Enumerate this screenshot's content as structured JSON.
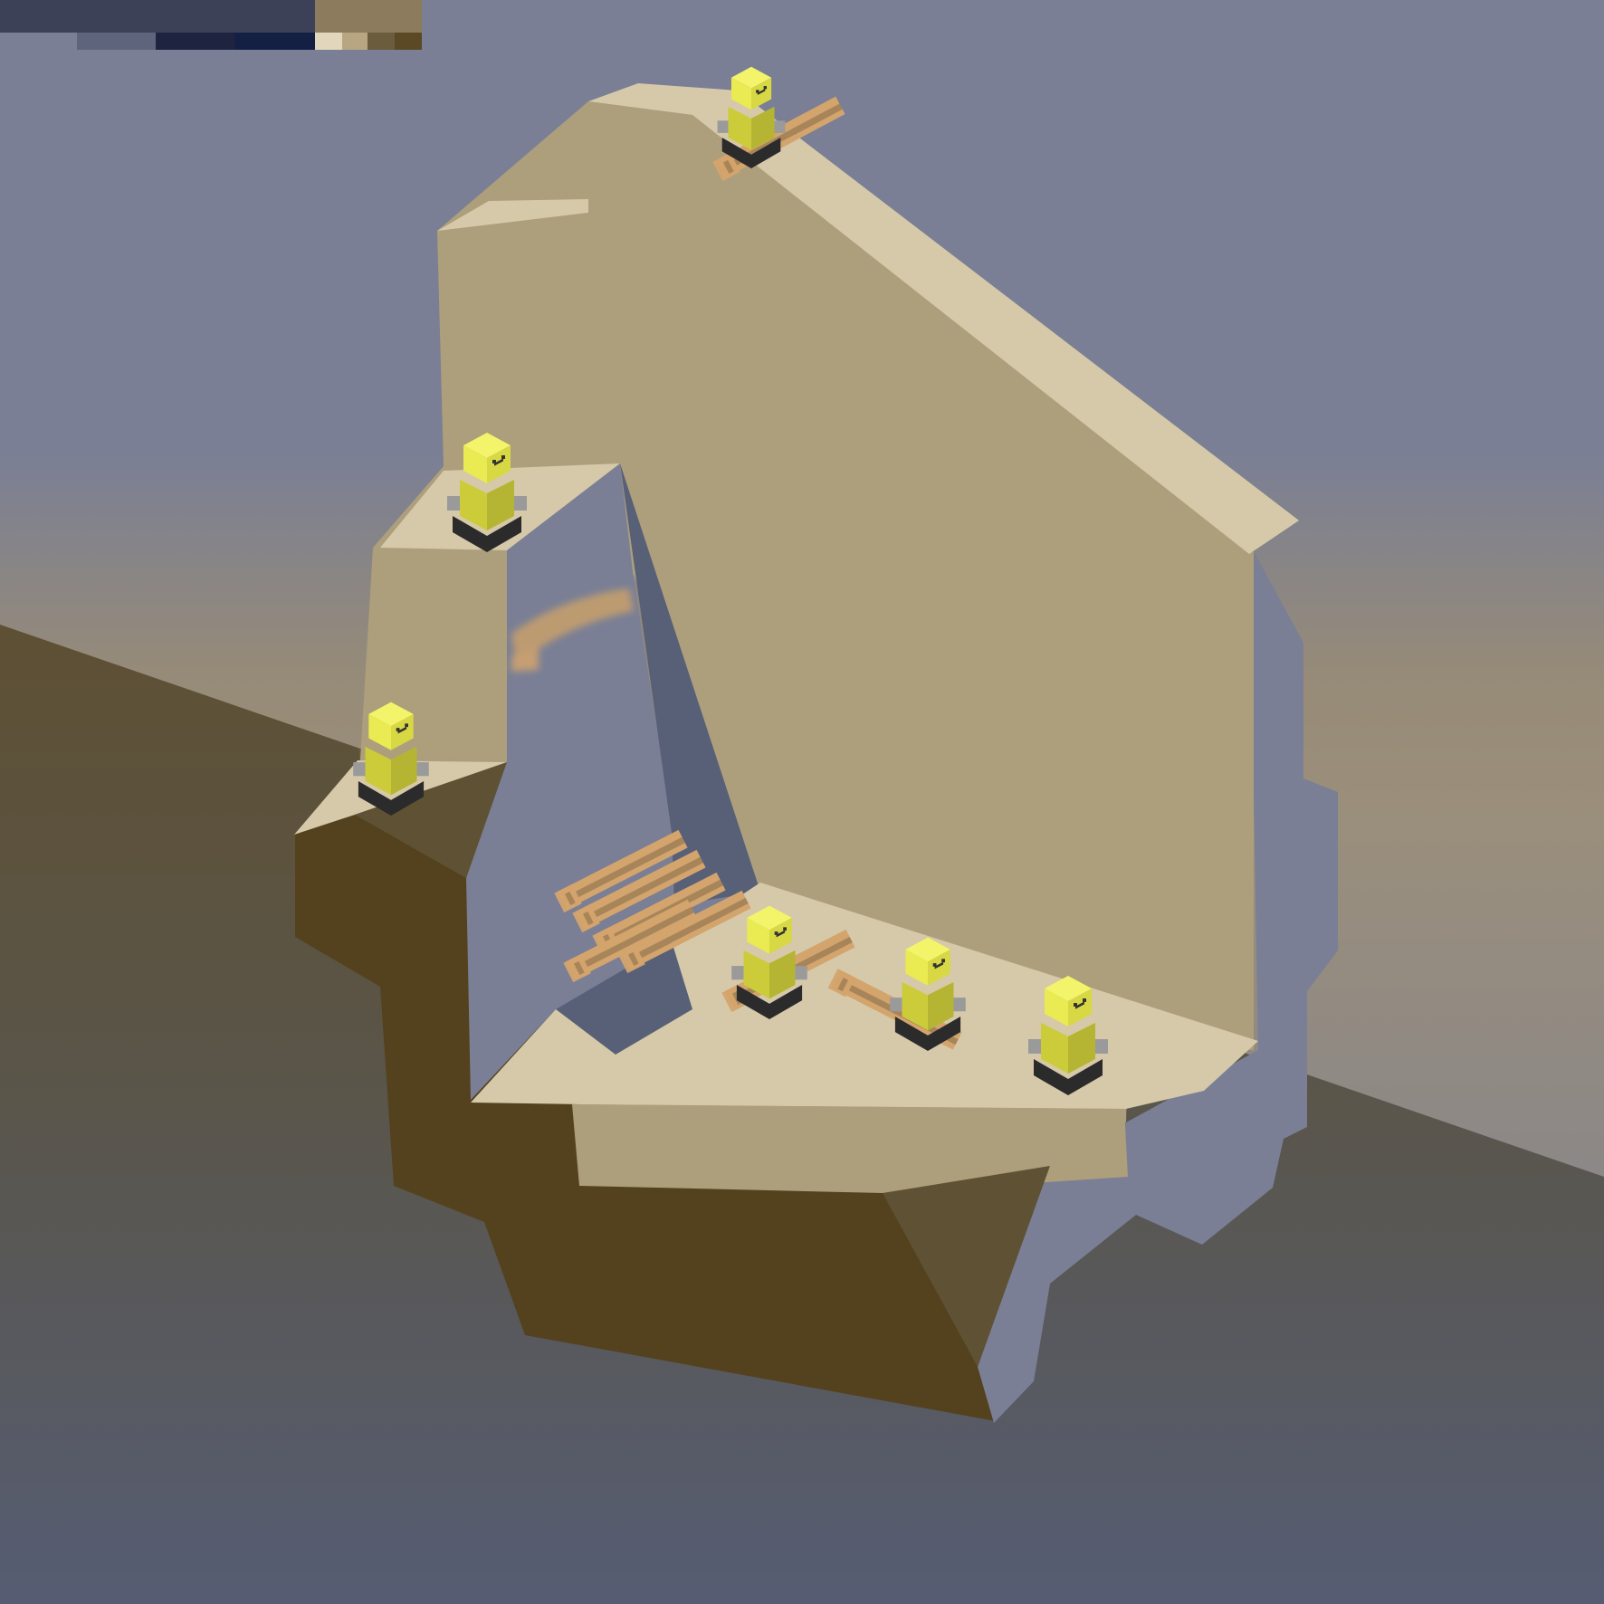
{
  "scene": {
    "colors": {
      "sky": "#7a7f95",
      "horizon_warm": "#9b8f7b",
      "ground_top": "#5e5034",
      "ground_bottom": "#565d73",
      "plateau_top": "#d6c9a9",
      "cliff_face": "#ad9f7c",
      "cliff_side": "#5f5133",
      "cliff_dark": "#54421e",
      "shadow_blue": "#7a7f95",
      "shadow_dark": "#586078",
      "girder": "#d4a46d",
      "girder_side": "#a88559",
      "robot_head": "#eaea52",
      "robot_body": "#cccc3a",
      "robot_tread": "#2b2b2b",
      "robot_arm": "#9a9a9a"
    },
    "robots": [
      {
        "name": "robot-top",
        "carrying": true
      },
      {
        "name": "robot-upper-ledge",
        "carrying": false
      },
      {
        "name": "robot-left-ledge",
        "carrying": false
      },
      {
        "name": "robot-floor-carrier",
        "carrying": true
      },
      {
        "name": "robot-floor-right",
        "carrying": false
      },
      {
        "name": "robot-floor-far-right",
        "carrying": false
      }
    ],
    "girder_stack_count": 5
  },
  "palette": {
    "swatches": [
      "#3d4158",
      "#8c7c5d",
      "#5d647c",
      "#1e2440",
      "#142043",
      "#e2d7bc",
      "#b8a683",
      "#6b5c3e",
      "#5a4924"
    ]
  }
}
